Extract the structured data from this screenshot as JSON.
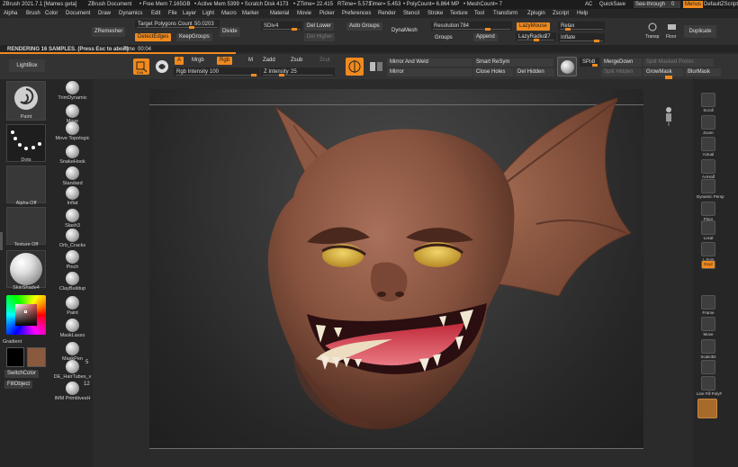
{
  "app": {
    "title": "ZBrush 2021.7.1 [Mames geta]",
    "document": "ZBrush Document",
    "free_mem": "• Free Mem 7.165GB",
    "active_mem": "• Active Mem 5399",
    "scratch": "• Scratch Disk 4173",
    "ztime": "• ZTime= 22.415",
    "rtime": "RTime= 5.571",
    "timer": "Timer= 5.453",
    "polycount": "• PolyCount= 6.864 MP",
    "meshcount": "• MeshCount= 7",
    "ac": "AC",
    "quicksave": "QuickSave",
    "see_through_label": "See-through",
    "see_through_value": "0",
    "menus_label": "Menus",
    "default_script": "DefaultZScript"
  },
  "menu": [
    "Alpha",
    "Brush",
    "Color",
    "Document",
    "Draw",
    "Dynamics",
    "Edit",
    "File",
    "Layer",
    "Light",
    "Macro",
    "Marker",
    "Material",
    "Movie",
    "Picker",
    "Preferences",
    "Render",
    "Stencil",
    "Stroke",
    "Texture",
    "Tool",
    "Transform",
    "Zplugin",
    "Zscript",
    "Help"
  ],
  "top": {
    "zremesher": "ZRemesher",
    "target_poly_label": "Target Polygons Count",
    "target_poly_value": "50.0203",
    "detect_edges": "DetectEdges",
    "keep_groups": "KeepGroups",
    "divide": "Divide",
    "sdiv_label": "SDiv",
    "sdiv_value": "4",
    "del_lower": "Del Lower",
    "del_higher": "Del Higher",
    "auto_groups": "Auto Groups",
    "dynamesh": "DynaMesh",
    "resolution_label": "Resolution",
    "resolution_value": "784",
    "groups": "Groups",
    "append": "Append",
    "lazy_mouse": "LazyMouse",
    "lazy_radius_label": "LazyRadius",
    "lazy_radius_value": "27",
    "relax": "Relax",
    "inflate": "Inflate",
    "transp": "Transp",
    "floor": "Floor",
    "duplicate": "Duplicate"
  },
  "render_bar": {
    "status": "RENDERING 16 SAMPLES. (Press Esc to abort)",
    "time_label": "Time",
    "time_value": "00:04",
    "progress": 0.32
  },
  "tools": {
    "edit": "Edit",
    "draw": "Draw",
    "a": "A",
    "mrgb": "Mrgb",
    "rgb": "Rgb",
    "m": "M",
    "zadd": "Zadd",
    "zsub": "Zsub",
    "zcut": "Zcut",
    "rgb_intensity_label": "Rgb Intensity",
    "rgb_intensity_value": "100",
    "z_intensity_label": "Z Intensity",
    "z_intensity_value": "25",
    "mirror_and_weld": "Mirror And Weld",
    "mirror": "Mirror",
    "smart_resym": "Smart ReSym",
    "close_holes": "Close Holes",
    "del_hidden": "Del Hidden",
    "spix_label": "SPix",
    "spix_value": "3",
    "merge_down": "MergeDown",
    "split_hidden": "Split Hidden",
    "split_masked": "Split Masked Points",
    "grow_mask": "GrowMask",
    "blur_mask": "BlurMask"
  },
  "left": {
    "lightbox": "LightBox",
    "paint": "Paint",
    "dots": "Dots",
    "alpha_off": "Alpha Off",
    "texture_off": "Texture Off",
    "material": "SkinShade4",
    "gradient": "Gradient",
    "switch_color": "SwitchColor",
    "fill_object": "FillObject"
  },
  "brushes": [
    {
      "label": "TrimDynamic"
    },
    {
      "label": "Move"
    },
    {
      "label": "Move Topologic"
    },
    {
      "label": "SnakeHook"
    },
    {
      "label": "Standard"
    },
    {
      "label": "Inflat"
    },
    {
      "label": "Slash3"
    },
    {
      "label": "Orb_Cracks"
    },
    {
      "label": "Pinch"
    },
    {
      "label": "ClayBuildup"
    },
    {
      "label": "Paint"
    },
    {
      "label": "MaskLasso"
    },
    {
      "label": "MaskPen"
    },
    {
      "label": "DE_HairTubes_v"
    },
    {
      "label": "IMM PrimitivesH"
    }
  ],
  "brush_counts": {
    "de_hair": "5",
    "imm": "12"
  },
  "right": [
    {
      "label": "Scroll",
      "icon": "scroll-icon"
    },
    {
      "label": "Zoom",
      "icon": "zoom-icon"
    },
    {
      "label": "Actual",
      "icon": "actual-icon"
    },
    {
      "label": "AAHalf",
      "icon": "aahalf-icon"
    },
    {
      "label": "Dynamic Persp",
      "icon": "persp-icon"
    },
    {
      "label": "Floor",
      "icon": "floor-icon"
    },
    {
      "label": "Local",
      "icon": "local-icon"
    },
    {
      "label": "L.Sym",
      "icon": "lsym-icon"
    },
    {
      "label": "Gxyz",
      "icon": "xyz-icon"
    },
    {
      "label": "Frame",
      "icon": "frame-icon"
    },
    {
      "label": "Move",
      "icon": "move-icon"
    },
    {
      "label": "Scale3D",
      "icon": "scale3d-icon"
    },
    {
      "label": "Rotate",
      "icon": "rotate-icon"
    },
    {
      "label": "Line Fill PolyF",
      "icon": "polyf-icon"
    }
  ],
  "colors": {
    "accent": "#f08a1e",
    "primary_color": "#000000",
    "secondary_color": "#8a5a3e"
  }
}
